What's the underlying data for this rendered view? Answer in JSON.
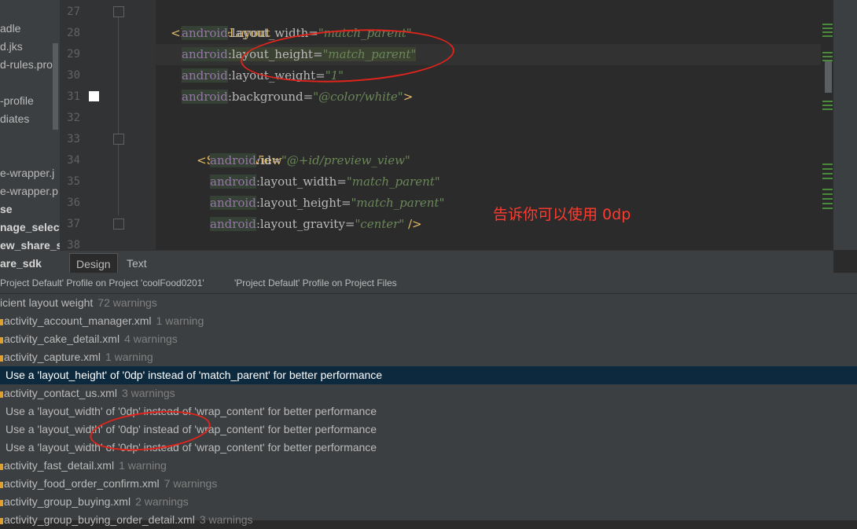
{
  "project_tree": {
    "items": [
      {
        "label": "adle",
        "bold": false
      },
      {
        "label": "d.jks",
        "bold": false
      },
      {
        "label": "d-rules.pro",
        "bold": false
      },
      {
        "label": "",
        "bold": false
      },
      {
        "label": "-profile",
        "bold": false
      },
      {
        "label": "diates",
        "bold": false
      },
      {
        "label": "",
        "bold": false
      },
      {
        "label": "",
        "bold": false
      },
      {
        "label": "e-wrapper.j",
        "bold": false
      },
      {
        "label": "e-wrapper.p",
        "bold": false
      },
      {
        "label": "se",
        "bold": true
      },
      {
        "label": "nage_selecto",
        "bold": true
      },
      {
        "label": "ew_share_sc",
        "bold": true
      },
      {
        "label": "are_sdk",
        "bold": true
      }
    ]
  },
  "editor": {
    "line_numbers": [
      "27",
      "28",
      "29",
      "30",
      "31",
      "32",
      "33",
      "34",
      "35",
      "36",
      "37",
      "38"
    ],
    "lines": {
      "l27": {
        "tag": "<RelativeLayout"
      },
      "l28": {
        "ns": "android",
        "colon": ":",
        "attr": "layout_width",
        "eq": "=",
        "val": "\"match_parent\""
      },
      "l29": {
        "ns": "android",
        "colon": ":",
        "attr": "layout_height",
        "eq": "=",
        "val": "\"match_parent\""
      },
      "l30": {
        "ns": "android",
        "colon": ":",
        "attr": "layout_weight",
        "eq": "=",
        "val": "\"1\""
      },
      "l31": {
        "ns": "android",
        "colon": ":",
        "attr": "background",
        "eq": "=",
        "val": "\"@color/white\"",
        "close": ">"
      },
      "l33": {
        "tag": "<SurfaceView"
      },
      "l34": {
        "ns": "android",
        "colon": ":",
        "attr": "id",
        "eq": "=",
        "val": "\"@+id/preview_view\""
      },
      "l35": {
        "ns": "android",
        "colon": ":",
        "attr": "layout_width",
        "eq": "=",
        "val": "\"match_parent\""
      },
      "l36": {
        "ns": "android",
        "colon": ":",
        "attr": "layout_height",
        "eq": "=",
        "val": "\"match_parent\""
      },
      "l37": {
        "ns": "android",
        "colon": ":",
        "attr": "layout_gravity",
        "eq": "=",
        "val": "\"center\"",
        "close": " />"
      }
    },
    "annotation_text": "告诉你可以使用 0dp"
  },
  "design_tabs": {
    "design": "Design",
    "text": "Text"
  },
  "inspection": {
    "header_profile_project": "Project Default' Profile on Project 'coolFood0201'",
    "header_profile_files": "'Project Default' Profile on Project Files",
    "rows": [
      {
        "label": "icient layout weight",
        "count": "72 warnings",
        "icon": false,
        "selected": false
      },
      {
        "label": "activity_account_manager.xml",
        "count": "1 warning",
        "icon": true,
        "selected": false
      },
      {
        "label": "activity_cake_detail.xml",
        "count": "4 warnings",
        "icon": true,
        "selected": false
      },
      {
        "label": "activity_capture.xml",
        "count": "1 warning",
        "icon": true,
        "selected": false
      },
      {
        "label": "Use a 'layout_height' of '0dp' instead of 'match_parent' for better performance",
        "count": "",
        "icon": false,
        "selected": true
      },
      {
        "label": "activity_contact_us.xml",
        "count": "3 warnings",
        "icon": true,
        "selected": false
      },
      {
        "label": "Use a 'layout_width' of '0dp' instead of 'wrap_content' for better performance",
        "count": "",
        "icon": false,
        "selected": false
      },
      {
        "label": "Use a 'layout_width' of '0dp' instead of 'wrap_content' for better performance",
        "count": "",
        "icon": false,
        "selected": false
      },
      {
        "label": "Use a 'layout_width' of '0dp' instead of 'wrap_content' for better performance",
        "count": "",
        "icon": false,
        "selected": false
      },
      {
        "label": "activity_fast_detail.xml",
        "count": "1 warning",
        "icon": true,
        "selected": false
      },
      {
        "label": "activity_food_order_confirm.xml",
        "count": "7 warnings",
        "icon": true,
        "selected": false
      },
      {
        "label": "activity_group_buying.xml",
        "count": "2 warnings",
        "icon": true,
        "selected": false
      },
      {
        "label": "activity_group_buying_order_detail.xml",
        "count": "3 warnings",
        "icon": true,
        "selected": false
      }
    ]
  },
  "colors": {
    "annotation": "#e0241c",
    "selection": "#0d293e",
    "tag": "#e8bf6a",
    "value": "#6a8759",
    "namespace": "#9876aa"
  }
}
